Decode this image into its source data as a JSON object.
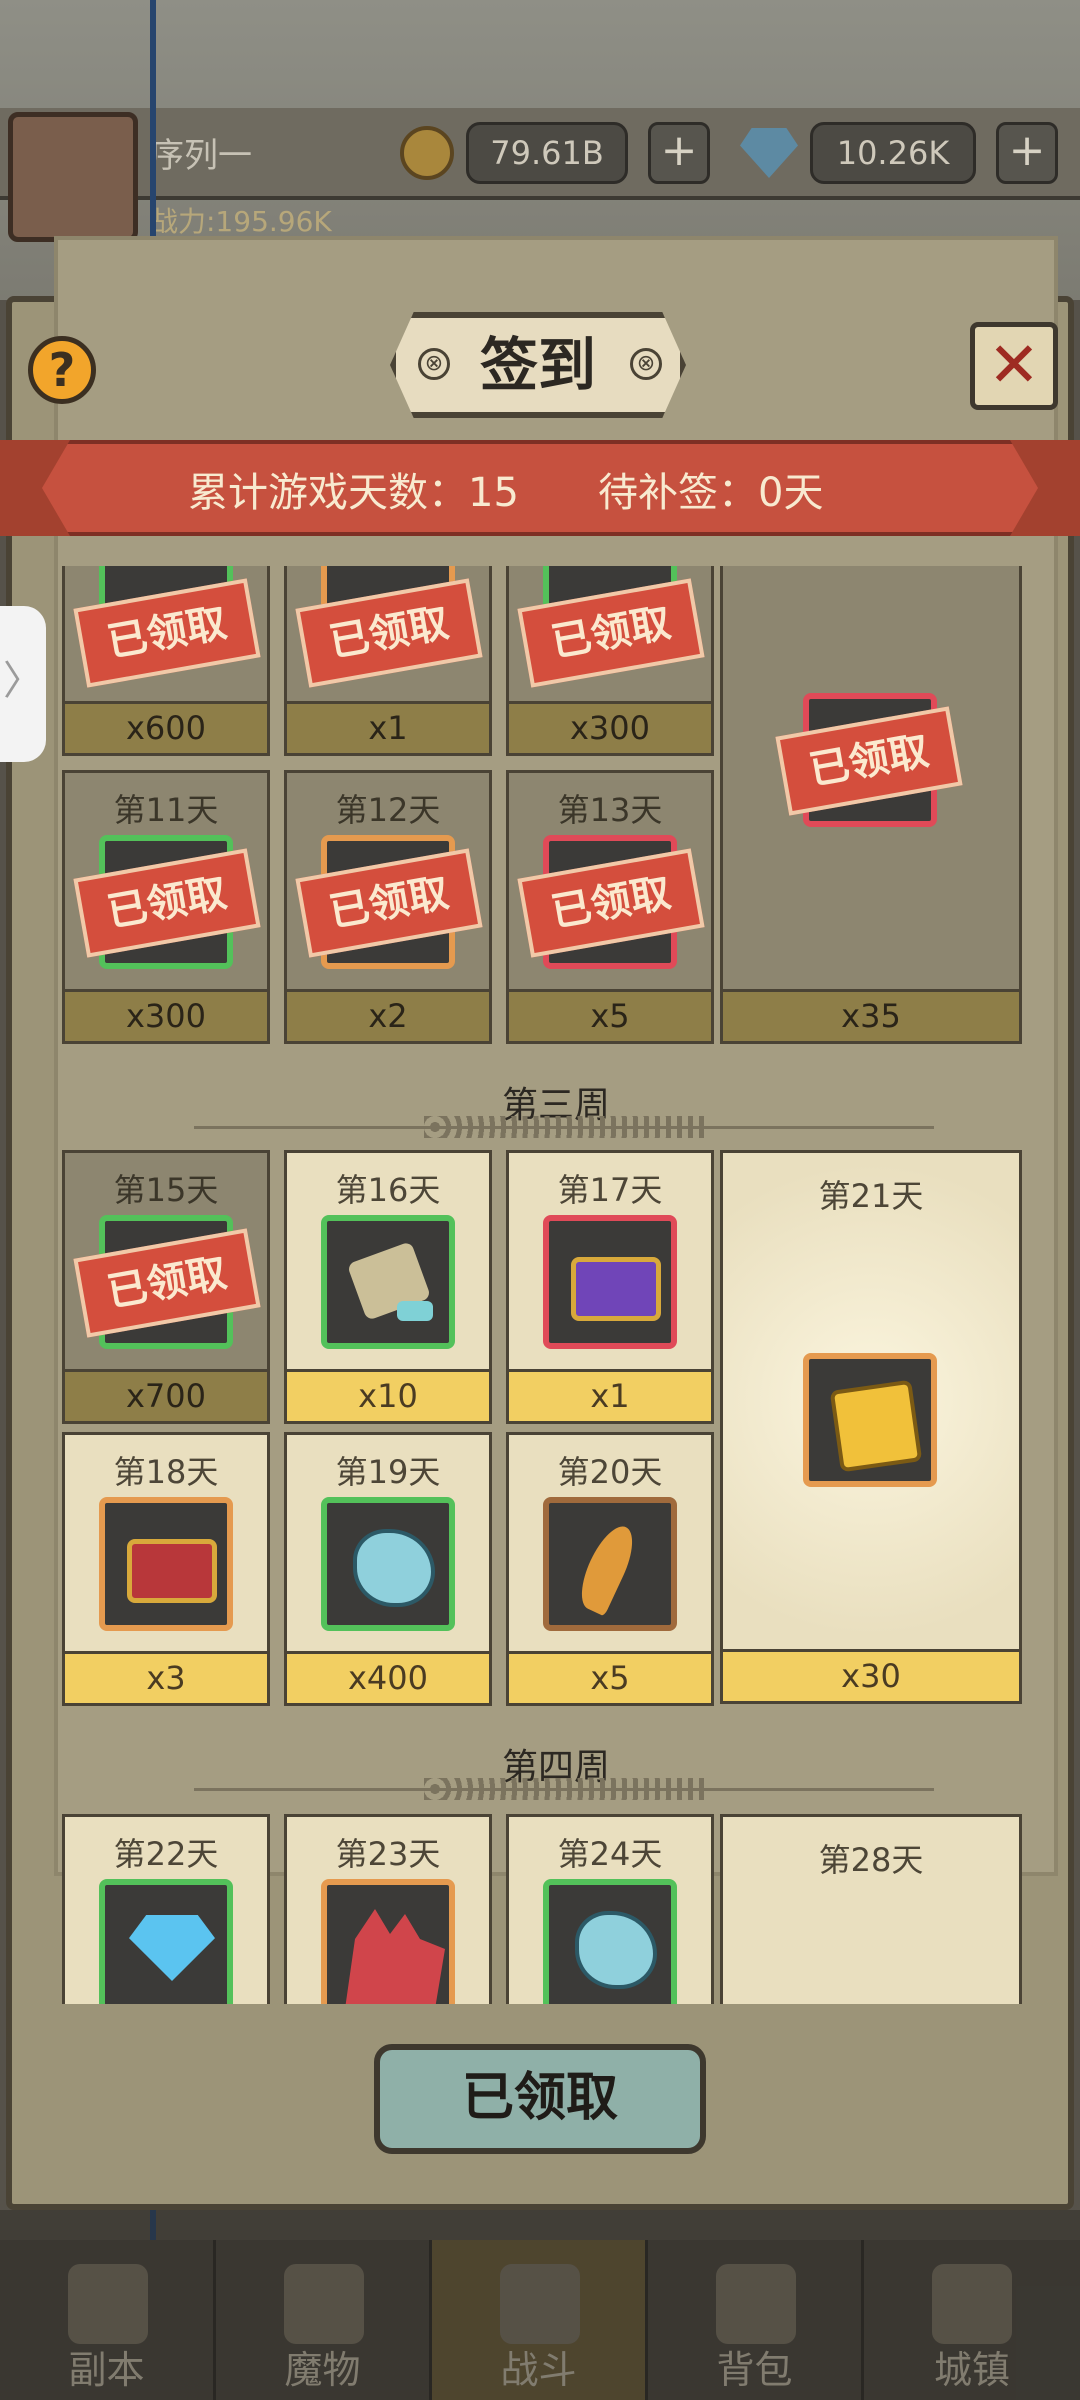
{
  "hud": {
    "player_name": "序列一",
    "power": "战力:195.96K",
    "gold": "79.61B",
    "diamonds": "10.26K",
    "plus_label": "+"
  },
  "modal": {
    "title": "签到",
    "help_label": "?",
    "close_label": "✕",
    "total_days_label": "累计游戏天数：15",
    "makeup_label": "待补签：0天",
    "claimed_stamp": "已领取",
    "claim_button": "已领取"
  },
  "week3_title": "第三周",
  "week4_title": "第四周",
  "rows_prev": [
    {
      "qty": "x600",
      "claimed": true
    },
    {
      "qty": "x1",
      "claimed": true
    },
    {
      "qty": "x300",
      "claimed": true
    }
  ],
  "week2_row2": [
    {
      "day": "第11天",
      "qty": "x300"
    },
    {
      "day": "第12天",
      "qty": "x2"
    },
    {
      "day": "第13天",
      "qty": "x5"
    }
  ],
  "week2_big": {
    "qty": "x35"
  },
  "week3": {
    "row1": [
      {
        "day": "第15天",
        "qty": "x700",
        "icon": "claimed"
      },
      {
        "day": "第16天",
        "qty": "x10",
        "icon": "scroll-icon"
      },
      {
        "day": "第17天",
        "qty": "x1",
        "icon": "purple-chest-icon"
      }
    ],
    "row2": [
      {
        "day": "第18天",
        "qty": "x3",
        "icon": "red-chest-icon"
      },
      {
        "day": "第19天",
        "qty": "x400",
        "icon": "blue-ore-icon"
      },
      {
        "day": "第20天",
        "qty": "x5",
        "icon": "feather-icon"
      }
    ],
    "big": {
      "day": "第21天",
      "qty": "x30",
      "icon": "puzzle-piece-icon"
    }
  },
  "week4": {
    "row1": [
      {
        "day": "第22天",
        "icon": "diamond-icon"
      },
      {
        "day": "第23天",
        "icon": "monster-icon"
      },
      {
        "day": "第24天",
        "icon": "blue-ore-icon"
      }
    ],
    "big": {
      "day": "第28天"
    }
  },
  "side_tab": "〉",
  "nav": [
    {
      "label": "副本"
    },
    {
      "label": "魔物"
    },
    {
      "label": "战斗"
    },
    {
      "label": "背包"
    },
    {
      "label": "城镇"
    }
  ]
}
